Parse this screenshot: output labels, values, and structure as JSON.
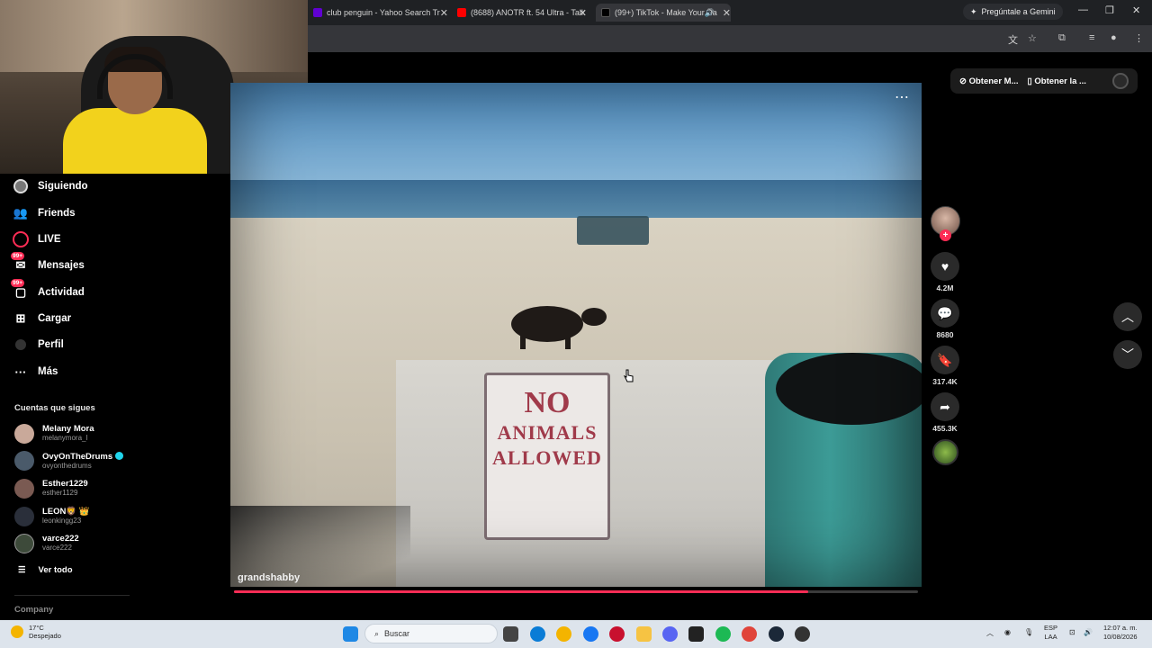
{
  "browser": {
    "tabs": [
      {
        "title": "club penguin - Yahoo Search Tr",
        "favicon_color": "#6001d2"
      },
      {
        "title": "(8688) ANOTR ft. 54 Ultra - Talk",
        "favicon_color": "#ff0000"
      },
      {
        "title": "(99+) TikTok - Make Your Da",
        "favicon_color": "#000000"
      }
    ],
    "gemini_label": "Pregúntale a Gemini"
  },
  "sidebar": {
    "nav": [
      {
        "label": "Siguiendo",
        "icon": "following-icon"
      },
      {
        "label": "Friends",
        "icon": "friends-icon"
      },
      {
        "label": "LIVE",
        "icon": "live-icon"
      },
      {
        "label": "Mensajes",
        "icon": "messages-icon",
        "badge": "99+"
      },
      {
        "label": "Actividad",
        "icon": "activity-icon",
        "badge": "99+"
      },
      {
        "label": "Cargar",
        "icon": "upload-icon"
      },
      {
        "label": "Perfil",
        "icon": "profile-icon"
      },
      {
        "label": "Más",
        "icon": "more-icon"
      }
    ],
    "following_title": "Cuentas que sigues",
    "accounts": [
      {
        "name": "Melany Mora",
        "handle": "melanymora_l"
      },
      {
        "name": "OvyOnTheDrums",
        "handle": "ovyonthedrums",
        "verified": true
      },
      {
        "name": "Esther1229",
        "handle": "esther1129"
      },
      {
        "name": "LEON",
        "name_suffix": "🦁 👑",
        "handle": "leonkingg23"
      },
      {
        "name": "varce222",
        "handle": "varce222"
      }
    ],
    "see_all": "Ver todo",
    "company": "Company"
  },
  "top_buttons": {
    "coins": "Obtener M...",
    "app": "Obtener la ..."
  },
  "video": {
    "author": "grandshabby",
    "sign_line1": "NO",
    "sign_line2": "ANIMALS",
    "sign_line3": "ALLOWED",
    "progress": 0.84
  },
  "actions": {
    "likes": "4.2M",
    "comments": "8680",
    "saves": "317.4K",
    "shares": "455.3K"
  },
  "taskbar": {
    "temp": "17°C",
    "weather": "Despejado",
    "search_placeholder": "Buscar",
    "lang_line1": "ESP",
    "lang_line2": "LAA",
    "time": "12:07 a. m.",
    "date": "10/08/2026"
  },
  "colors": {
    "accent": "#fe2c55",
    "verified": "#20d5ec"
  }
}
